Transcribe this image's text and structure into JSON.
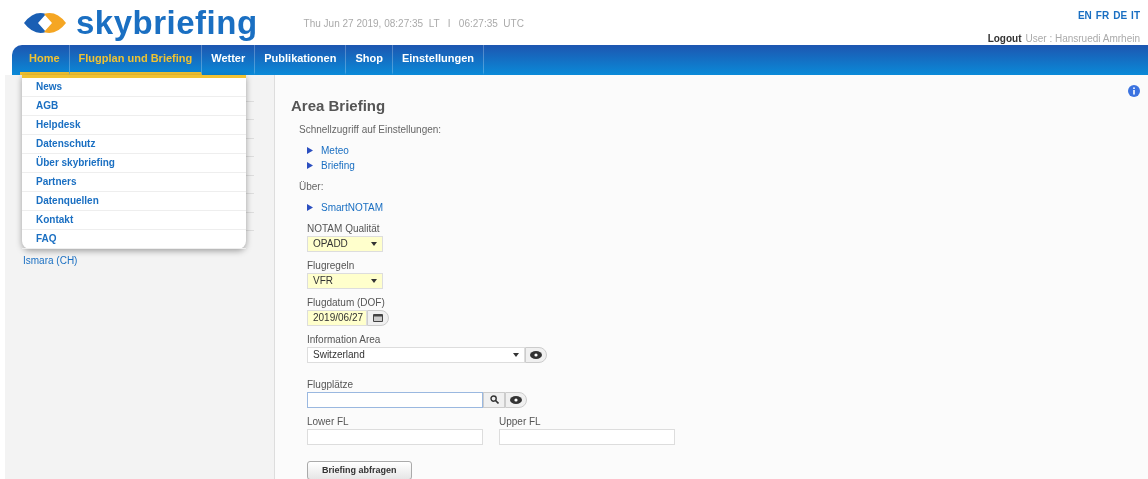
{
  "header": {
    "logo_text": "skybriefing",
    "datetime": "Thu Jun 27 2019, 08:27:35  LT   I   06:27:35  UTC",
    "languages": [
      "EN",
      "FR",
      "DE",
      "IT"
    ],
    "logout": "Logout",
    "user": "User : Hansruedi Amrhein"
  },
  "nav": [
    {
      "label": "Home",
      "selected": true
    },
    {
      "label": "Flugplan und Briefing",
      "selected": true
    },
    {
      "label": "Wetter",
      "selected": false
    },
    {
      "label": "Publikationen",
      "selected": false
    },
    {
      "label": "Shop",
      "selected": false
    },
    {
      "label": "Einstellungen",
      "selected": false
    }
  ],
  "dropdown": [
    "News",
    "AGB",
    "Helpdesk",
    "Datenschutz",
    "Über skybriefing",
    "Partners",
    "Datenquellen",
    "Kontakt",
    "FAQ"
  ],
  "sidebar": {
    "visible_item": "Ismara (CH)"
  },
  "content": {
    "title": "Area Briefing",
    "quick_label": "Schnellzugriff auf Einstellungen:",
    "quick_links": [
      "Meteo",
      "Briefing"
    ],
    "about_label": "Über:",
    "about_links": [
      "SmartNOTAM"
    ],
    "fields": [
      {
        "kind": "select",
        "label": "NOTAM Qualität",
        "value": "OPADD",
        "highlighted": true
      },
      {
        "kind": "select",
        "label": "Flugregeln",
        "value": "VFR",
        "highlighted": true
      },
      {
        "kind": "date",
        "label": "Flugdatum (DOF)",
        "value": "2019/06/27",
        "highlighted": true
      },
      {
        "kind": "combo",
        "label": "Information Area",
        "value": "Switzerland",
        "highlighted": false
      },
      {
        "kind": "search",
        "label": "Flugplätze",
        "highlighted": false
      }
    ],
    "fl_fields": [
      {
        "label": "Lower FL"
      },
      {
        "label": "Upper FL"
      }
    ],
    "submit": "Briefing abfragen"
  }
}
